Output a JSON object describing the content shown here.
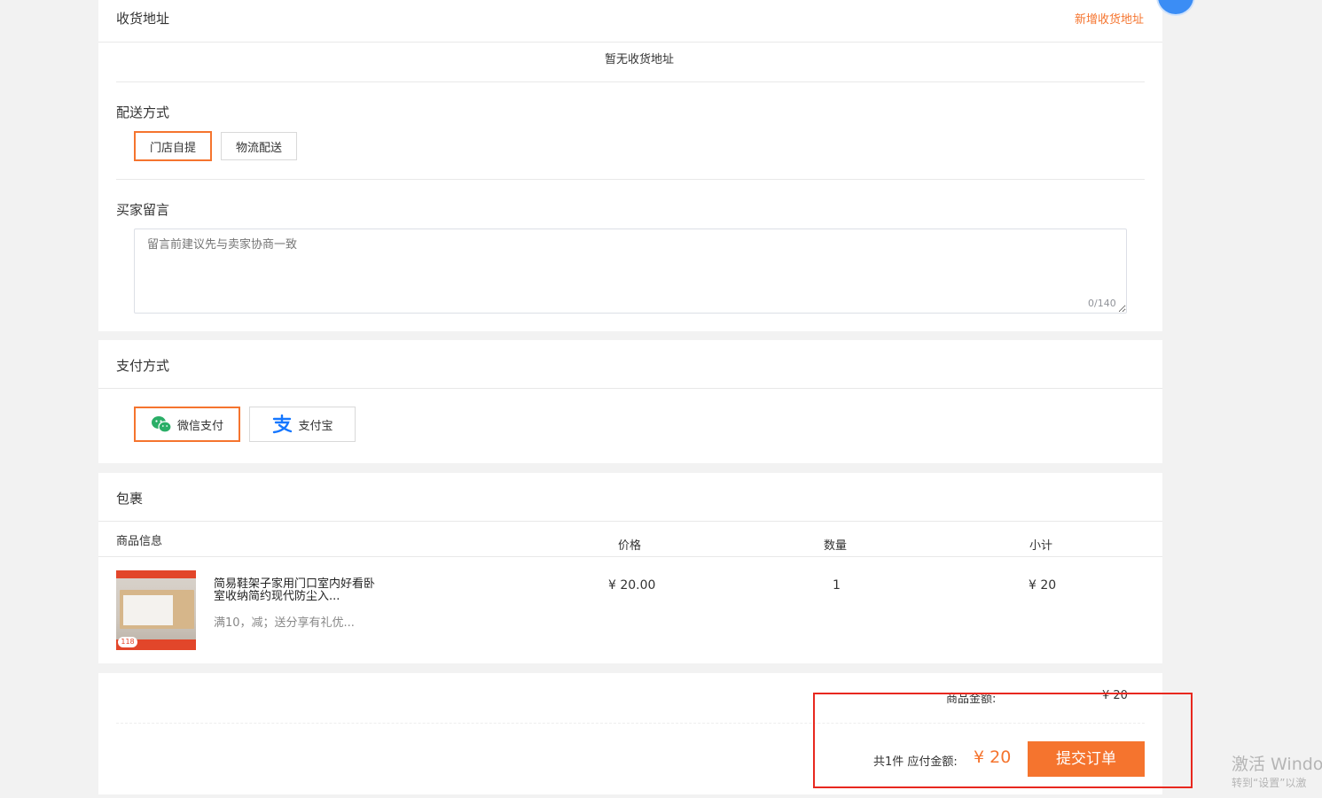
{
  "address": {
    "title": "收货地址",
    "add_link": "新增收货地址",
    "empty_text": "暂无收货地址"
  },
  "delivery": {
    "title": "配送方式",
    "options": [
      {
        "label": "门店自提",
        "selected": true
      },
      {
        "label": "物流配送",
        "selected": false
      }
    ]
  },
  "message": {
    "title": "买家留言",
    "placeholder": "留言前建议先与卖家协商一致",
    "counter": "0/140"
  },
  "payment": {
    "title": "支付方式",
    "options": [
      {
        "label": "微信支付",
        "icon": "wechat-pay-icon",
        "selected": true
      },
      {
        "label": "支付宝",
        "icon": "alipay-icon",
        "selected": false
      }
    ]
  },
  "package": {
    "title": "包裹",
    "columns": {
      "info": "商品信息",
      "price": "价格",
      "qty": "数量",
      "subtotal": "小计"
    },
    "items": [
      {
        "image_badge": "118",
        "name": "简易鞋架子家用门口室内好看卧室收纳简约现代防尘入...",
        "promo": "满10，减；送分享有礼优...",
        "price": "¥ 20.00",
        "qty": "1",
        "subtotal": "¥ 20"
      }
    ]
  },
  "summary": {
    "goods_amount_label": "商品金额:",
    "goods_amount_value": "¥ 20",
    "count_text": "共1件 应付金额:",
    "total": "¥ 20",
    "submit_label": "提交订单"
  },
  "watermark": {
    "line1": "激活 Windo",
    "line2": "转到“设置”以激"
  },
  "colors": {
    "accent": "#f5742e",
    "wechat_green": "#2aae67",
    "alipay_blue": "#1677ff",
    "highlight_red": "#e8281f"
  }
}
